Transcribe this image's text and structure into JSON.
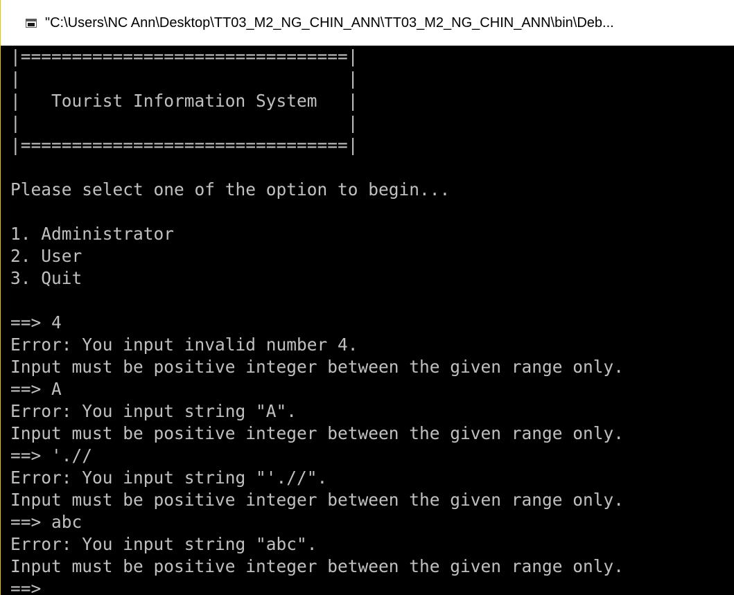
{
  "window": {
    "title": "\"C:\\Users\\NC Ann\\Desktop\\TT03_M2_NG_CHIN_ANN\\TT03_M2_NG_CHIN_ANN\\bin\\Deb...",
    "icon": "console-window-icon"
  },
  "console": {
    "banner": {
      "top_border": "|================================|",
      "blank_1": "|                                |",
      "title_line": "|   Tourist Information System   |",
      "blank_2": "|                                |",
      "bottom_border": "|================================|"
    },
    "prompt_text": "Please select one of the option to begin...",
    "menu": [
      "1. Administrator",
      "2. User",
      "3. Quit"
    ],
    "session": [
      {
        "input": "==> 4",
        "error": "Error: You input invalid number 4.",
        "hint": "Input must be positive integer between the given range only."
      },
      {
        "input": "==> A",
        "error": "Error: You input string \"A\".",
        "hint": "Input must be positive integer between the given range only."
      },
      {
        "input": "==> './/",
        "error": "Error: You input string \"'.//\".",
        "hint": "Input must be positive integer between the given range only."
      },
      {
        "input": "==> abc",
        "error": "Error: You input string \"abc\".",
        "hint": "Input must be positive integer between the given range only."
      }
    ],
    "current_prompt": "==> _"
  },
  "colors": {
    "console_background": "#000000",
    "console_text": "#c0c0c0",
    "titlebar_background": "#ffffff"
  }
}
